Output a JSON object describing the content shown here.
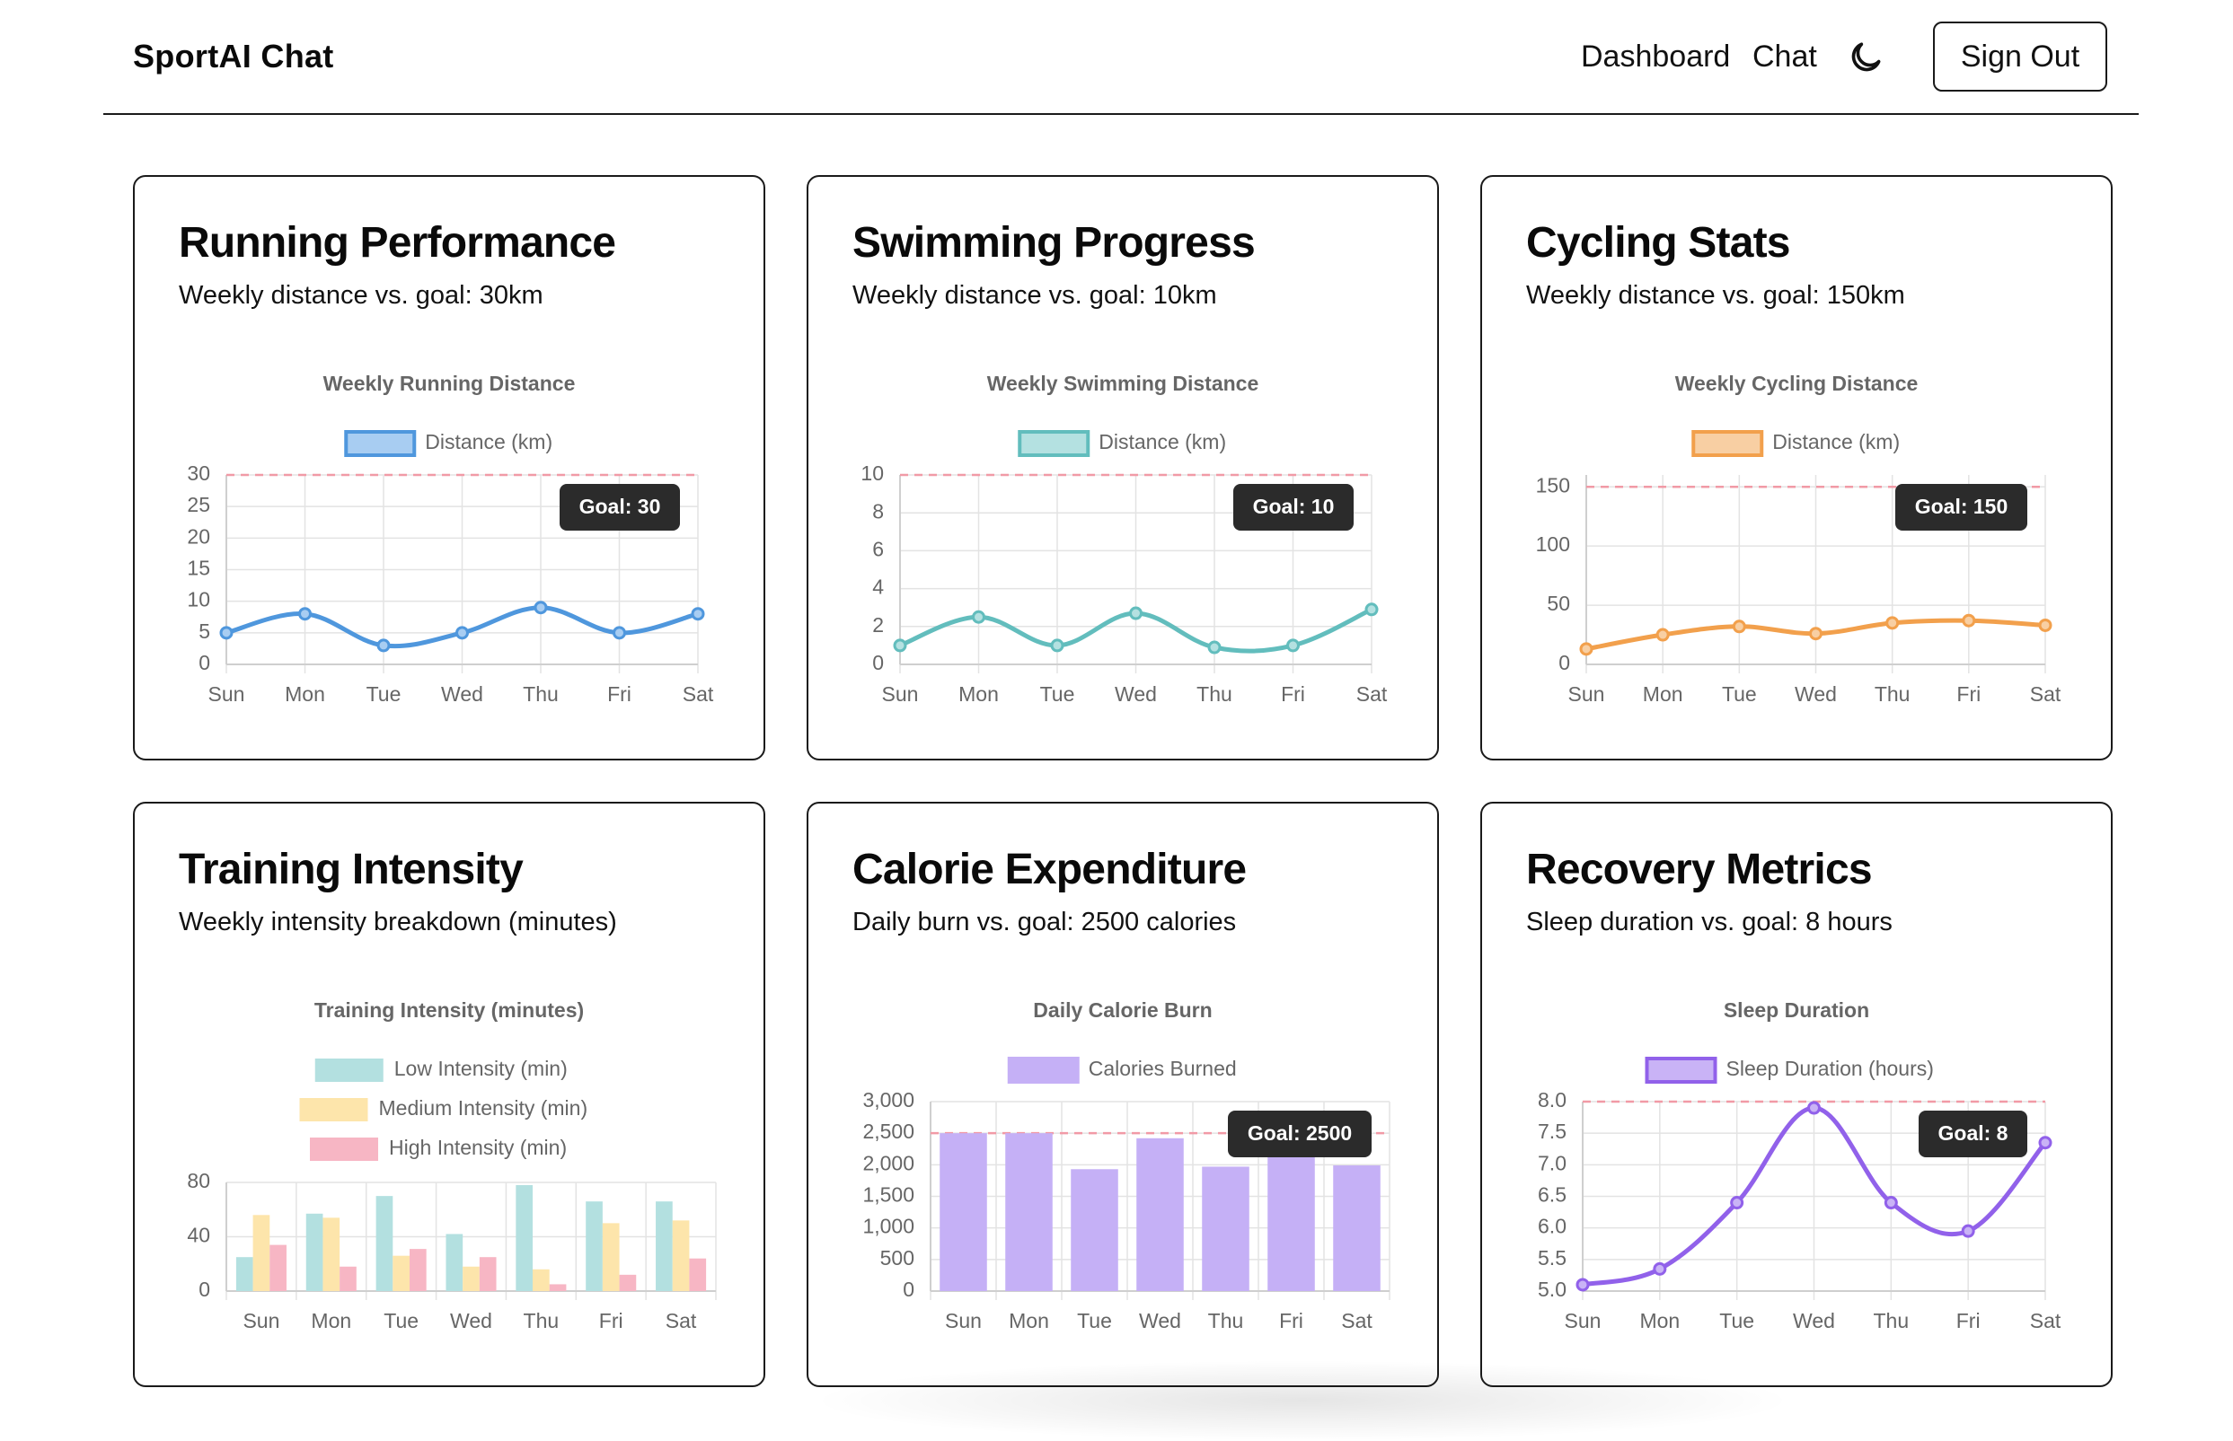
{
  "header": {
    "brand": "SportAI Chat",
    "nav": [
      "Dashboard",
      "Chat"
    ],
    "theme_toggle_icon": "moon-icon",
    "sign_out": "Sign Out"
  },
  "cards": [
    {
      "title": "Running Performance",
      "subtitle": "Weekly distance vs. goal: 30km"
    },
    {
      "title": "Swimming Progress",
      "subtitle": "Weekly distance vs. goal: 10km"
    },
    {
      "title": "Cycling Stats",
      "subtitle": "Weekly distance vs. goal: 150km"
    },
    {
      "title": "Training Intensity",
      "subtitle": "Weekly intensity breakdown (minutes)"
    },
    {
      "title": "Calorie Expenditure",
      "subtitle": "Daily burn vs. goal: 2500 calories"
    },
    {
      "title": "Recovery Metrics",
      "subtitle": "Sleep duration vs. goal: 8 hours"
    }
  ],
  "chart_data": [
    {
      "type": "line",
      "title": "Weekly Running Distance",
      "categories": [
        "Sun",
        "Mon",
        "Tue",
        "Wed",
        "Thu",
        "Fri",
        "Sat"
      ],
      "series": [
        {
          "name": "Distance (km)",
          "values": [
            5,
            8,
            3,
            5,
            9,
            5,
            8
          ]
        }
      ],
      "ylim": [
        0,
        30
      ],
      "yticks": [
        "0",
        "5",
        "10",
        "15",
        "20",
        "25",
        "30"
      ],
      "ytick_values": [
        0,
        5,
        10,
        15,
        20,
        25,
        30
      ],
      "goal": 30,
      "goal_label": "Goal: 30",
      "color": "#4f97dd",
      "fill": "#a8cdf2",
      "grid": true,
      "legend": "top"
    },
    {
      "type": "line",
      "title": "Weekly Swimming Distance",
      "categories": [
        "Sun",
        "Mon",
        "Tue",
        "Wed",
        "Thu",
        "Fri",
        "Sat"
      ],
      "series": [
        {
          "name": "Distance (km)",
          "values": [
            1,
            2.5,
            1,
            2.7,
            0.9,
            1,
            2.9
          ]
        }
      ],
      "ylim": [
        0,
        10
      ],
      "yticks": [
        "0",
        "2",
        "4",
        "6",
        "8",
        "10"
      ],
      "ytick_values": [
        0,
        2,
        4,
        6,
        8,
        10
      ],
      "goal": 10,
      "goal_label": "Goal: 10",
      "color": "#62bdbd",
      "fill": "#b4e1e1",
      "grid": true,
      "legend": "top"
    },
    {
      "type": "line",
      "title": "Weekly Cycling Distance",
      "categories": [
        "Sun",
        "Mon",
        "Tue",
        "Wed",
        "Thu",
        "Fri",
        "Sat"
      ],
      "series": [
        {
          "name": "Distance (km)",
          "values": [
            13,
            25,
            32,
            26,
            35,
            37,
            33
          ]
        }
      ],
      "ylim": [
        0,
        160
      ],
      "yticks": [
        "0",
        "50",
        "100",
        "150"
      ],
      "ytick_values": [
        0,
        50,
        100,
        150
      ],
      "goal": 150,
      "goal_label": "Goal: 150",
      "color": "#f2a04c",
      "fill": "#f8cfa3",
      "grid": true,
      "legend": "top"
    },
    {
      "type": "bar",
      "title": "Training Intensity (minutes)",
      "categories": [
        "Sun",
        "Mon",
        "Tue",
        "Wed",
        "Thu",
        "Fri",
        "Sat"
      ],
      "series": [
        {
          "name": "Low Intensity (min)",
          "values": [
            25,
            57,
            70,
            42,
            78,
            66,
            66
          ],
          "color": "#b3e0e0"
        },
        {
          "name": "Medium Intensity (min)",
          "values": [
            56,
            54,
            26,
            18,
            16,
            50,
            52
          ],
          "color": "#fde5ab"
        },
        {
          "name": "High Intensity (min)",
          "values": [
            34,
            18,
            31,
            25,
            5,
            12,
            24
          ],
          "color": "#f7b6c4"
        }
      ],
      "ylim": [
        0,
        80
      ],
      "yticks": [
        "0",
        "40",
        "80"
      ],
      "ytick_values": [
        0,
        40,
        80
      ],
      "grid": true,
      "legend": "top"
    },
    {
      "type": "bar",
      "title": "Daily Calorie Burn",
      "categories": [
        "Sun",
        "Mon",
        "Tue",
        "Wed",
        "Thu",
        "Fri",
        "Sat"
      ],
      "series": [
        {
          "name": "Calories Burned",
          "values": [
            2500,
            2500,
            1930,
            2420,
            1970,
            2350,
            1990
          ]
        }
      ],
      "ylim": [
        0,
        3000
      ],
      "yticks": [
        "0",
        "500",
        "1,000",
        "1,500",
        "2,000",
        "2,500",
        "3,000"
      ],
      "ytick_values": [
        0,
        500,
        1000,
        1500,
        2000,
        2500,
        3000
      ],
      "goal": 2500,
      "goal_label": "Goal: 2500",
      "color": "#c5b0f6",
      "fill": "#c5b0f6",
      "grid": true,
      "legend": "top"
    },
    {
      "type": "line",
      "title": "Sleep Duration",
      "categories": [
        "Sun",
        "Mon",
        "Tue",
        "Wed",
        "Thu",
        "Fri",
        "Sat"
      ],
      "series": [
        {
          "name": "Sleep Duration (hours)",
          "values": [
            5.1,
            5.35,
            6.4,
            7.9,
            6.4,
            5.95,
            7.35
          ]
        }
      ],
      "ylim": [
        5,
        8
      ],
      "yticks": [
        "5.0",
        "5.5",
        "6.0",
        "6.5",
        "7.0",
        "7.5",
        "8.0"
      ],
      "ytick_values": [
        5,
        5.5,
        6,
        6.5,
        7,
        7.5,
        8
      ],
      "goal": 8,
      "goal_label": "Goal: 8",
      "color": "#9161ea",
      "fill": "#c9b3f6",
      "grid": true,
      "legend": "top"
    }
  ]
}
